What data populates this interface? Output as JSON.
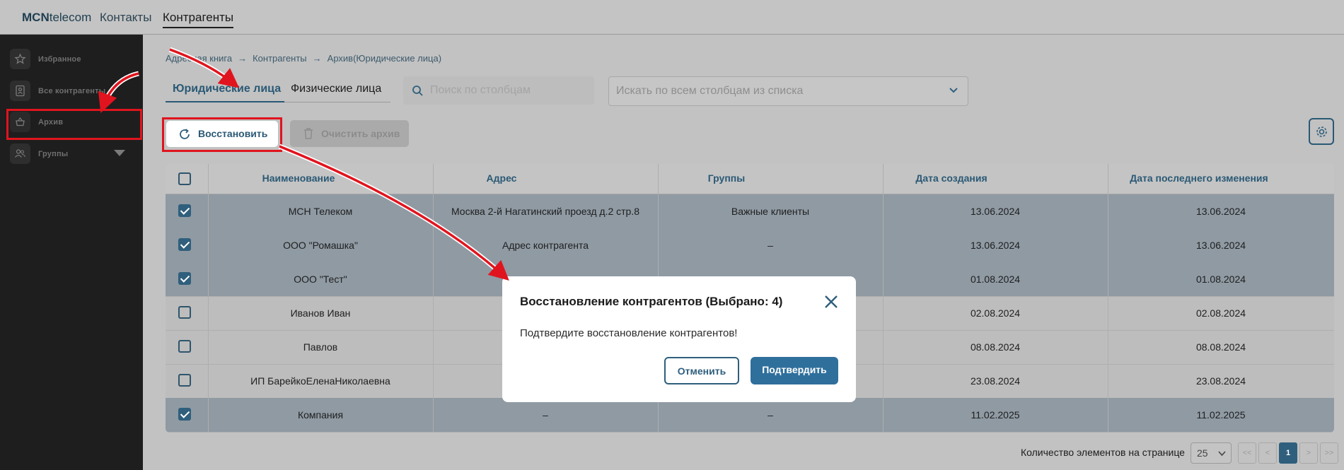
{
  "app": {
    "logo_bold": "MCN",
    "logo_rest": "telecom",
    "nav": [
      "Контакты",
      "Контрагенты"
    ]
  },
  "sidebar": {
    "items": [
      {
        "label": "Избранное",
        "icon": "star-icon"
      },
      {
        "label": "Все контрагенты",
        "icon": "contact-card-icon"
      },
      {
        "label": "Архив",
        "icon": "basket-icon"
      },
      {
        "label": "Группы",
        "icon": "users-icon"
      }
    ]
  },
  "breadcrumb": [
    "Адресная книга",
    "Контрагенты",
    "Архив(Юридические лица)"
  ],
  "tabs": [
    "Юридические лица",
    "Физические лица"
  ],
  "search": {
    "placeholder": "Поиск по столбцам"
  },
  "filter_select": {
    "placeholder": "Искать по всем столбцам из списка"
  },
  "toolbar": {
    "restore_label": "Восстановить",
    "clear_label": "Очистить архив"
  },
  "table": {
    "columns": [
      "Наименование",
      "Адрес",
      "Группы",
      "Дата создания",
      "Дата последнего изменения"
    ],
    "rows": [
      {
        "checked": true,
        "name": "МСН Телеком",
        "address": "Москва 2-й Нагатинский проезд д.2 стр.8",
        "groups": "Важные клиенты",
        "created": "13.06.2024",
        "modified": "13.06.2024"
      },
      {
        "checked": true,
        "name": "ООО \"Ромашка\"",
        "address": "Адрес контрагента",
        "groups": "–",
        "created": "13.06.2024",
        "modified": "13.06.2024"
      },
      {
        "checked": true,
        "name": "ООО \"Тест\"",
        "address": "",
        "groups": "",
        "created": "01.08.2024",
        "modified": "01.08.2024"
      },
      {
        "checked": false,
        "name": "Иванов Иван",
        "address": "",
        "groups": "",
        "created": "02.08.2024",
        "modified": "02.08.2024"
      },
      {
        "checked": false,
        "name": "Павлов",
        "address": "",
        "groups": "",
        "created": "08.08.2024",
        "modified": "08.08.2024"
      },
      {
        "checked": false,
        "name": "ИП БарейкоЕленаНиколаевна",
        "address": "",
        "groups": "",
        "created": "23.08.2024",
        "modified": "23.08.2024"
      },
      {
        "checked": true,
        "name": "Компания",
        "address": "–",
        "groups": "–",
        "created": "11.02.2025",
        "modified": "11.02.2025"
      }
    ]
  },
  "pagination": {
    "per_page_label": "Количество элементов на странице",
    "per_page_value": "25",
    "first": "<<",
    "prev": "<",
    "current": "1",
    "next": ">",
    "last": ">>"
  },
  "modal": {
    "title": "Восстановление контрагентов (Выбрано: 4)",
    "message": "Подтвердите восстановление контрагентов!",
    "cancel_label": "Отменить",
    "confirm_label": "Подтвердить"
  },
  "colors": {
    "accent": "#2a5975",
    "annotation": "#e0141e"
  }
}
